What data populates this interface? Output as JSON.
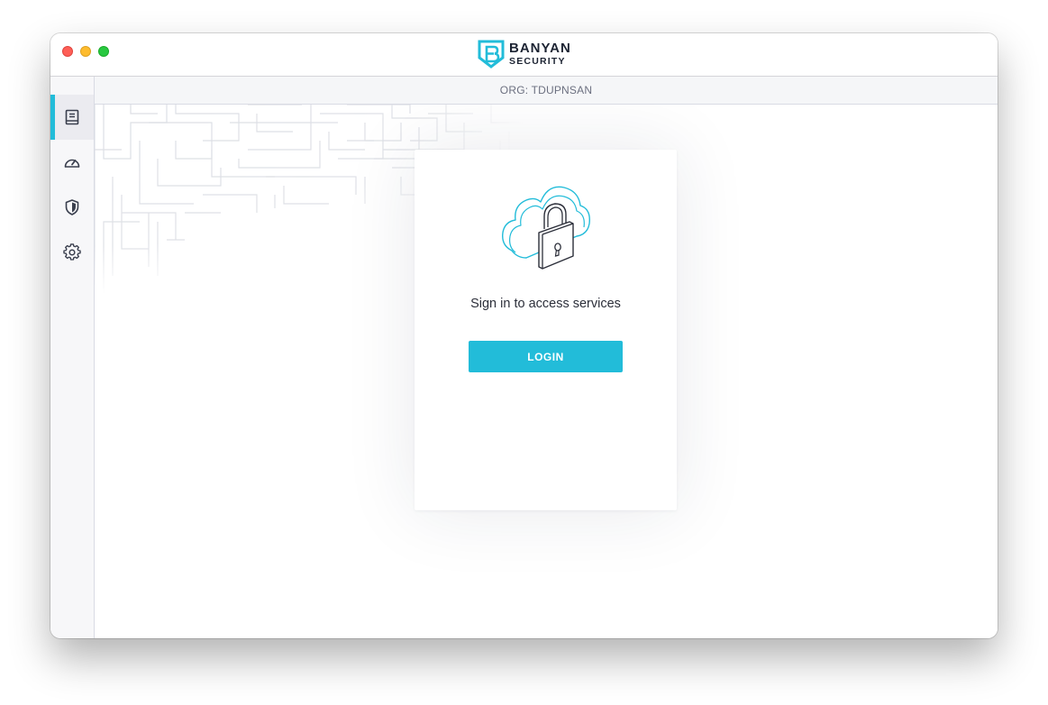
{
  "window": {
    "traffic_lights": [
      "close",
      "minimize",
      "zoom"
    ]
  },
  "brand": {
    "line1": "BANYAN",
    "line2": "SECURITY",
    "logo_icon": "banyan-shield-logo",
    "accent_color": "#22bcd9"
  },
  "sidebar": {
    "items": [
      {
        "icon": "book-icon",
        "active": true
      },
      {
        "icon": "speedometer-icon",
        "active": false
      },
      {
        "icon": "shield-icon",
        "active": false
      },
      {
        "icon": "gear-icon",
        "active": false
      }
    ]
  },
  "org_bar": {
    "label": "ORG: TDUPNSAN"
  },
  "card": {
    "illustration": "cloud-lock-icon",
    "message": "Sign in to access services",
    "login_label": "LOGIN"
  },
  "colors": {
    "accent": "#22bcd9",
    "text_dark": "#2c2f3a",
    "sidebar_bg": "#f7f7f9"
  }
}
